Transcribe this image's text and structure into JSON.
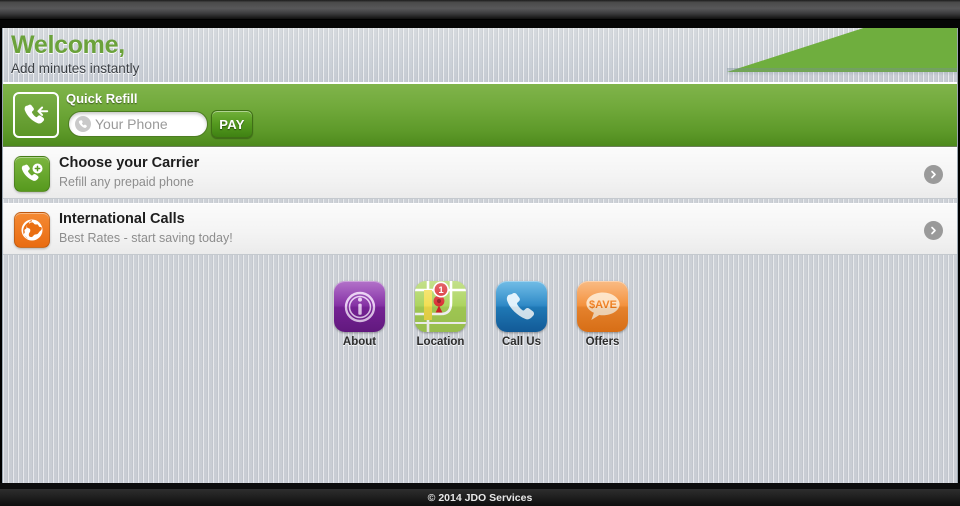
{
  "header": {
    "title": "Welcome,",
    "subtitle": "Add minutes instantly",
    "accent_color": "#6ba23b",
    "wedge_color": "#6fae3e"
  },
  "quick_refill": {
    "title": "Quick Refill",
    "icon": "phone-incoming-icon",
    "input_placeholder": "Your Phone",
    "input_value": "",
    "input_icon": "phone-handset-icon",
    "pay_label": "PAY",
    "band_color": "#72aa3c"
  },
  "rows": [
    {
      "title": "Choose your Carrier",
      "subtitle": "Refill any prepaid phone",
      "icon": "phone-add-icon",
      "icon_color": "#6aa92e",
      "chevron": "chevron-right-icon"
    },
    {
      "title": "International Calls",
      "subtitle": "Best Rates - start saving today!",
      "icon": "globe-icon",
      "icon_color": "#ef7a18",
      "chevron": "chevron-right-icon"
    }
  ],
  "apps": [
    {
      "label": "About",
      "icon": "info-circle-icon",
      "color": "#7a22a0"
    },
    {
      "label": "Location",
      "icon": "map-pin-icon",
      "color": "#8cc63f",
      "badge": "1"
    },
    {
      "label": "Call Us",
      "icon": "phone-handset-icon",
      "color": "#1f7cc0"
    },
    {
      "label": "Offers",
      "icon": "save-bubble-icon",
      "color": "#ef7a18",
      "bubble_text": "$AVE"
    }
  ],
  "footer": {
    "copyright": "© 2014 JDO Services"
  }
}
